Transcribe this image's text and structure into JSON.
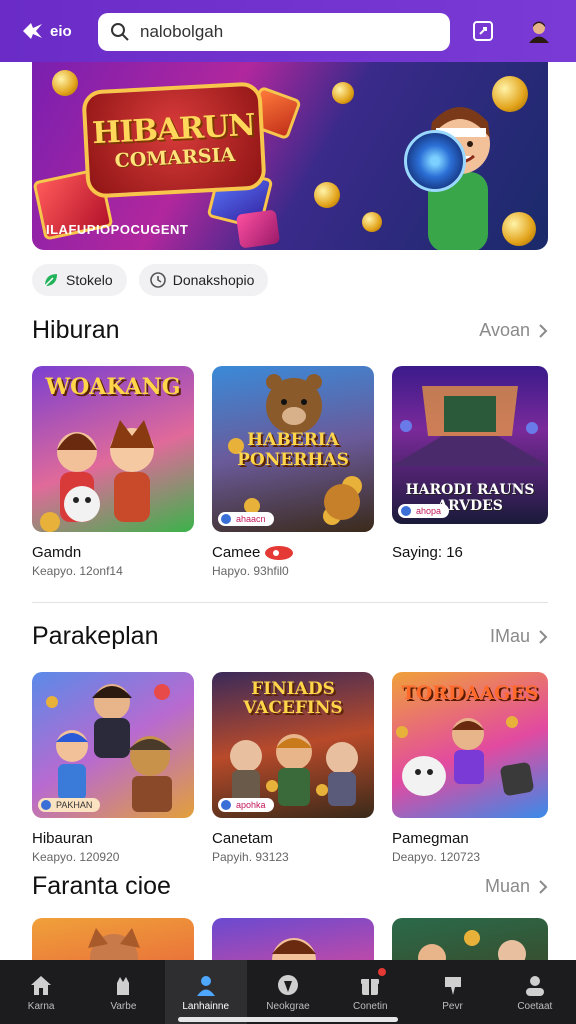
{
  "header": {
    "logo_text": "eio",
    "search_value": "nalobolgah",
    "brand_color": "#6a2bc6"
  },
  "banner": {
    "title_line1": "HIBARUN",
    "title_line2": "COMARSIA",
    "subtitle": "ILAFUPIOPOCUGENT"
  },
  "chips": [
    {
      "label": "Stokelo",
      "icon": "leaf-icon"
    },
    {
      "label": "Donakshopio",
      "icon": "clock-icon"
    }
  ],
  "sections": [
    {
      "title": "Hiburan",
      "see_all": "Avoan",
      "cards": [
        {
          "caption": "WOAKANG",
          "name": "Gamdn",
          "meta": "Keapyo. 12onf14",
          "badge": ""
        },
        {
          "caption": "HABERIA PONERHAS",
          "name": "Camee",
          "meta": "Hapyo. 93hfil0",
          "badge": "ahaacn"
        },
        {
          "caption": "HARODI RAUNS ARVDES",
          "name": "Saying: 16",
          "meta": "",
          "badge": "ahopa"
        }
      ]
    },
    {
      "title": "Parakeplan",
      "see_all": "IMau",
      "cards": [
        {
          "caption": "",
          "name": "Hibauran",
          "meta": "Keapyo. 120920",
          "badge": "PAKHAN"
        },
        {
          "caption": "FINIADS VACEFINS",
          "name": "Canetam",
          "meta": "Papyih. 93123",
          "badge": "apohka"
        },
        {
          "caption": "TORDAAGES",
          "name": "Pamegman",
          "meta": "Deapyo. 120723",
          "badge": ""
        }
      ]
    },
    {
      "title": "Faranta cioe",
      "see_all": "Muan"
    }
  ],
  "bottom_nav": [
    {
      "label": "Karna",
      "icon": "home-icon"
    },
    {
      "label": "Varbe",
      "icon": "cat-icon"
    },
    {
      "label": "Lanhainne",
      "icon": "person-icon",
      "active": true
    },
    {
      "label": "Neokgrae",
      "icon": "compass-icon"
    },
    {
      "label": "Conetin",
      "icon": "gift-icon",
      "notification": true
    },
    {
      "label": "Pevr",
      "icon": "pin-icon"
    },
    {
      "label": "Coetaat",
      "icon": "profile-icon"
    }
  ]
}
